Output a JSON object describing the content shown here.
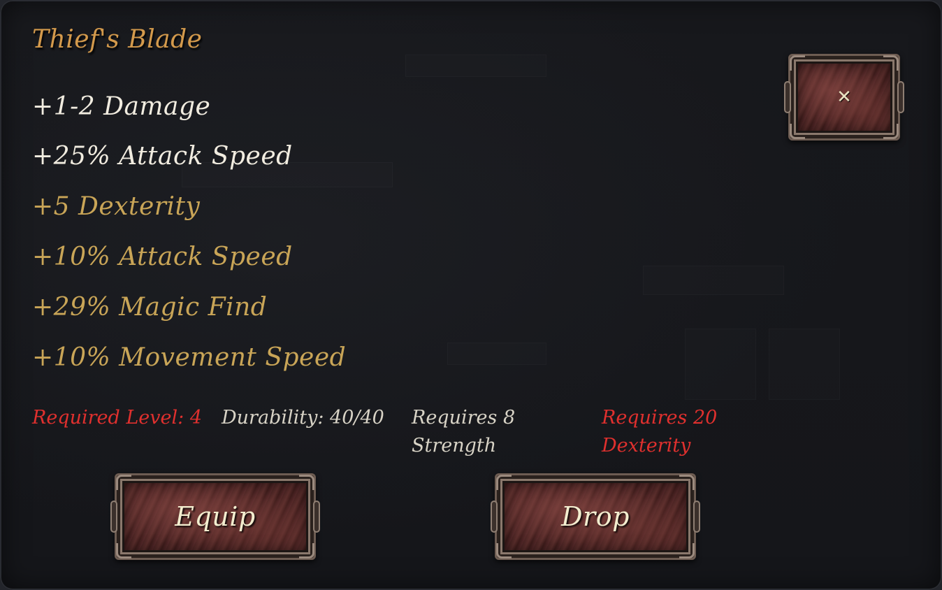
{
  "item": {
    "name": "Thief's Blade",
    "base_stats": [
      "+1-2 Damage",
      "+25% Attack Speed"
    ],
    "magic_stats": [
      "+5 Dexterity",
      "+10% Attack Speed",
      "+29% Magic Find",
      "+10% Movement Speed"
    ],
    "requirements": {
      "level": "Required Level: 4",
      "durability": "Durability: 40/40",
      "strength_line1": "Requires 8",
      "strength_line2": "Strength",
      "dexterity_line1": "Requires 20",
      "dexterity_line2": "Dexterity"
    }
  },
  "buttons": {
    "equip": "Equip",
    "drop": "Drop",
    "close_icon": "close-icon",
    "close_glyph": "✕"
  },
  "colors": {
    "title": "#d49a4c",
    "base_stat": "#f1ece0",
    "magic_stat": "#c9a557",
    "unmet_requirement": "#e0302e",
    "met_requirement": "#d8d3c6",
    "button_face": "#4d2625"
  }
}
